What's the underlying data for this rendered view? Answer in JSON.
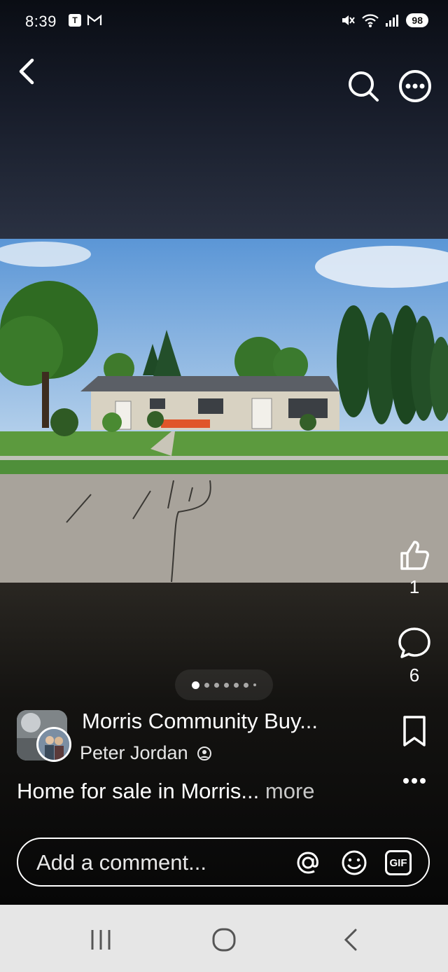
{
  "status": {
    "time": "8:39",
    "notifications": [
      "T",
      "M"
    ],
    "battery": "98"
  },
  "icons": {
    "back": "back-arrow-icon",
    "search": "search-icon",
    "more": "more-options-icon",
    "like": "thumbs-up-icon",
    "comment": "comment-bubble-icon",
    "save": "bookmark-icon",
    "actions": "horizontal-dots-icon"
  },
  "actions": {
    "like_count": "1",
    "comment_count": "6"
  },
  "pager": {
    "current": 1,
    "total": 7
  },
  "post": {
    "group_name": "Morris Community Buy...",
    "author": "Peter Jordan",
    "caption": "Home for sale in Morris...",
    "more_label": "more"
  },
  "comment": {
    "placeholder": "Add a comment...",
    "gif_label": "GIF"
  },
  "colors": {
    "nav_bar": "#e6e6e6",
    "sky": "#6fa6dc",
    "grass": "#4f8f3a",
    "road": "#a8a39b"
  }
}
